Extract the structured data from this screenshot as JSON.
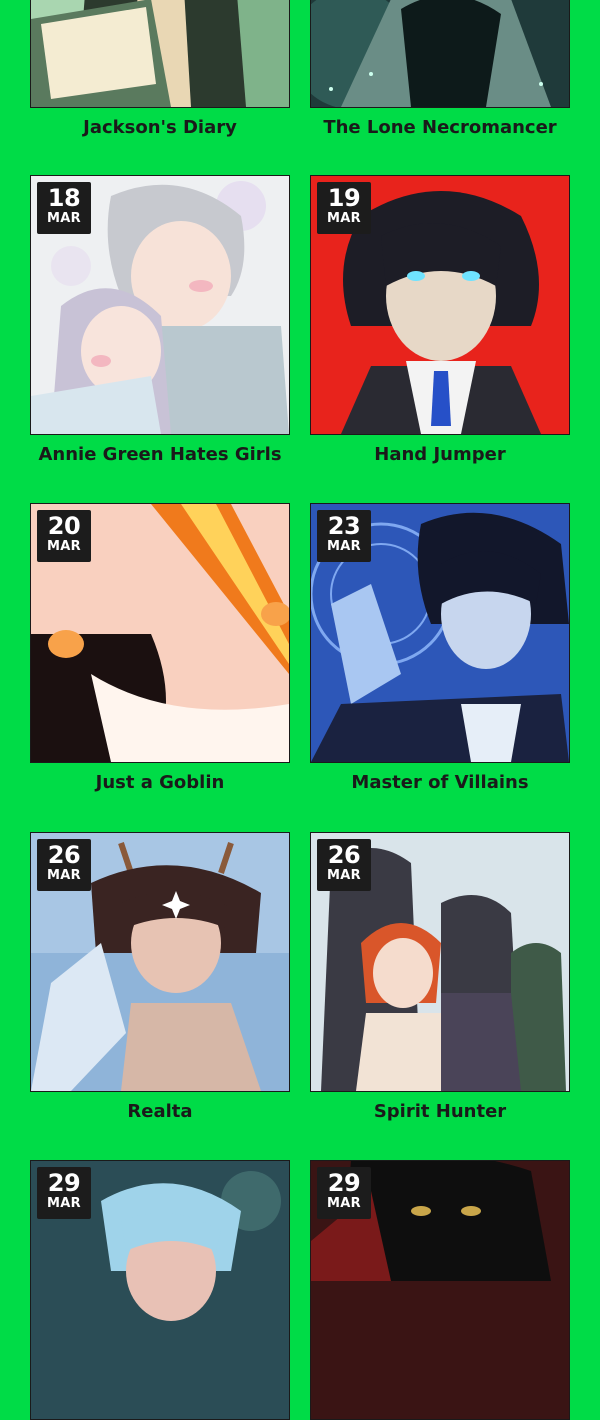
{
  "cards": [
    {
      "title": "Jackson's Diary",
      "day": "",
      "month": "",
      "art": "book-reader-art",
      "palette": [
        "#a9d6b0",
        "#2c3a2e",
        "#e9d7b4"
      ]
    },
    {
      "title": "The Lone Necromancer",
      "day": "",
      "month": "",
      "art": "necromancer-art",
      "palette": [
        "#1f3a3a",
        "#6a8d86",
        "#0d1a1a"
      ]
    },
    {
      "title": "Annie Green Hates Girls",
      "day": "18",
      "month": "MAR",
      "art": "couple-art",
      "palette": [
        "#eef0f2",
        "#c8c2d6",
        "#f7d9d6"
      ]
    },
    {
      "title": "Hand Jumper",
      "day": "19",
      "month": "MAR",
      "art": "dark-hair-boy-art",
      "palette": [
        "#e8231c",
        "#1d1d26",
        "#f3f3f3"
      ]
    },
    {
      "title": "Just a Goblin",
      "day": "20",
      "month": "MAR",
      "art": "goblin-art",
      "palette": [
        "#f6b49e",
        "#1b1010",
        "#f07a1c"
      ]
    },
    {
      "title": "Master of Villains",
      "day": "23",
      "month": "MAR",
      "art": "villain-art",
      "palette": [
        "#2d57b8",
        "#12172b",
        "#a9c7f2"
      ]
    },
    {
      "title": "Realta",
      "day": "26",
      "month": "MAR",
      "art": "antler-boy-art",
      "palette": [
        "#8fb4d9",
        "#3a2422",
        "#e7c3b3"
      ]
    },
    {
      "title": "Spirit Hunter",
      "day": "26",
      "month": "MAR",
      "art": "group-art",
      "palette": [
        "#d9e4ea",
        "#3a3a44",
        "#d9562a"
      ]
    },
    {
      "title": "",
      "day": "29",
      "month": "MAR",
      "art": "blue-hair-boy-art",
      "palette": [
        "#2b4d56",
        "#9fd3ea",
        "#e8c1b5"
      ]
    },
    {
      "title": "",
      "day": "29",
      "month": "MAR",
      "art": "monster-art",
      "palette": [
        "#3a1414",
        "#c9a64a",
        "#0e0e0e"
      ]
    }
  ]
}
